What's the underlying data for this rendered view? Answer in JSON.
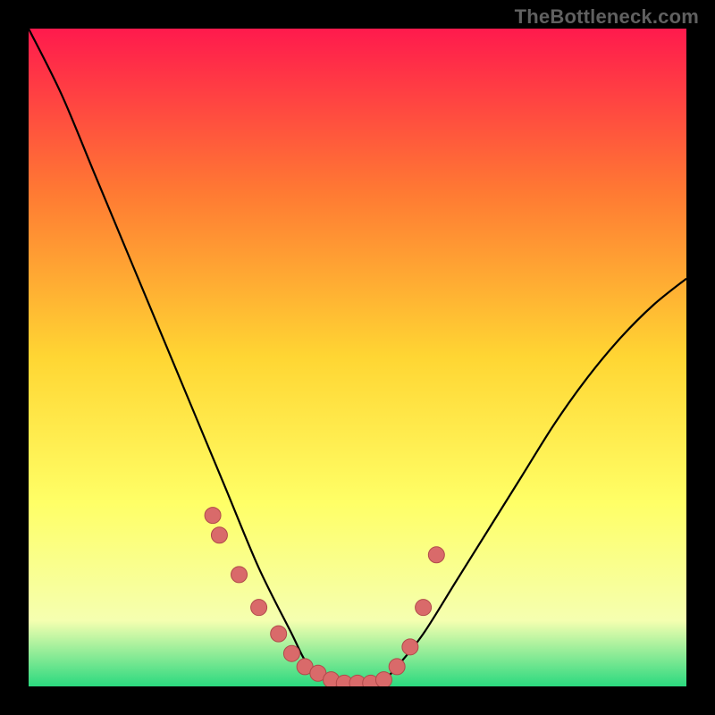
{
  "watermark": "TheBottleneck.com",
  "colors": {
    "bg_frame": "#000000",
    "grad_top": "#ff1a4d",
    "grad_mid1": "#ff7a33",
    "grad_mid2": "#ffd633",
    "grad_mid3": "#ffff66",
    "grad_low": "#f5ffb0",
    "grad_bottom": "#2bd97f",
    "curve": "#000000",
    "marker_fill": "#d96a6a",
    "marker_stroke": "#b04a4a"
  },
  "chart_data": {
    "type": "line",
    "title": "",
    "xlabel": "",
    "ylabel": "",
    "xlim": [
      0,
      100
    ],
    "ylim": [
      0,
      100
    ],
    "series": [
      {
        "name": "bottleneck-curve",
        "x": [
          0,
          5,
          10,
          15,
          20,
          25,
          30,
          35,
          40,
          42,
          44,
          46,
          48,
          50,
          52,
          54,
          56,
          60,
          65,
          70,
          75,
          80,
          85,
          90,
          95,
          100
        ],
        "y": [
          100,
          90,
          78,
          66,
          54,
          42,
          30,
          18,
          8,
          4,
          2,
          1,
          0.5,
          0.5,
          0.5,
          1,
          3,
          8,
          16,
          24,
          32,
          40,
          47,
          53,
          58,
          62
        ]
      }
    ],
    "markers": {
      "name": "highlight-points",
      "x": [
        28,
        29,
        32,
        35,
        38,
        40,
        42,
        44,
        46,
        48,
        50,
        52,
        54,
        56,
        58,
        60,
        62
      ],
      "y": [
        26,
        23,
        17,
        12,
        8,
        5,
        3,
        2,
        1,
        0.5,
        0.5,
        0.5,
        1,
        3,
        6,
        12,
        20
      ]
    },
    "background_gradient_stops": [
      {
        "offset": 0.0,
        "approx_y": 100,
        "color": "#ff1a4d"
      },
      {
        "offset": 0.25,
        "approx_y": 75,
        "color": "#ff7a33"
      },
      {
        "offset": 0.5,
        "approx_y": 50,
        "color": "#ffd633"
      },
      {
        "offset": 0.72,
        "approx_y": 28,
        "color": "#ffff66"
      },
      {
        "offset": 0.9,
        "approx_y": 10,
        "color": "#f5ffb0"
      },
      {
        "offset": 1.0,
        "approx_y": 0,
        "color": "#2bd97f"
      }
    ]
  }
}
